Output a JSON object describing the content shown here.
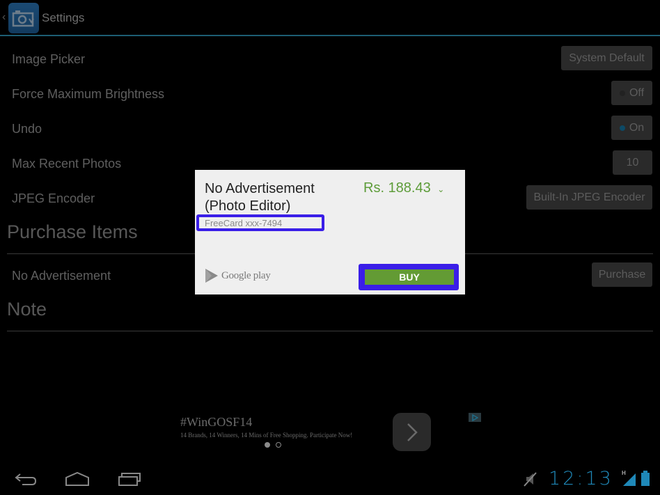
{
  "action_bar": {
    "title": "Settings",
    "accent_color": "#1d5e74"
  },
  "settings": [
    {
      "label": "Image Picker",
      "value": "System Default"
    },
    {
      "label": "Force Maximum Brightness",
      "value": "Off",
      "toggle": false
    },
    {
      "label": "Undo",
      "value": "On",
      "toggle": true
    },
    {
      "label": "Max Recent Photos",
      "value": "10"
    },
    {
      "label": "JPEG Encoder",
      "value": "Built-In JPEG Encoder"
    }
  ],
  "sections": {
    "purchase_items": "Purchase Items",
    "note": "Note"
  },
  "purchase": {
    "item_label": "No Advertisement",
    "button_label": "Purchase"
  },
  "dialog": {
    "title": "No Advertisement (Photo Editor)",
    "price": "Rs. 188.43",
    "payment_method": "FreeCard xxx-7494",
    "store_label": "Google play",
    "buy_label": "BUY",
    "price_color": "#5d9c39",
    "buy_color": "#639b34",
    "highlight_color": "#3a1ee8"
  },
  "ad_banner": {
    "title": "#WinGOSF14",
    "subtitle": "14 Brands, 14 Winners, 14 Mins of Free Shopping. Participate Now!",
    "pages": 2,
    "current_page": 1
  },
  "system_bar": {
    "time": "12:13",
    "network": "H",
    "clock_color": "#1f88b8"
  }
}
